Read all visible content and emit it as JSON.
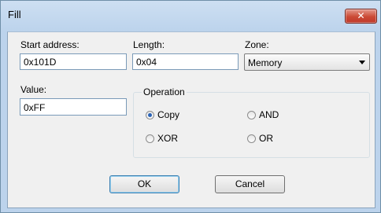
{
  "window": {
    "title": "Fill",
    "close_glyph": "✕"
  },
  "fields": {
    "start_address": {
      "label": "Start address:",
      "value": "0x101D"
    },
    "length": {
      "label": "Length:",
      "value": "0x04"
    },
    "zone": {
      "label": "Zone:",
      "selected": "Memory"
    },
    "value": {
      "label": "Value:",
      "value": "0xFF"
    }
  },
  "operation": {
    "title": "Operation",
    "options": [
      {
        "label": "Copy",
        "checked": true
      },
      {
        "label": "AND",
        "checked": false
      },
      {
        "label": "XOR",
        "checked": false
      },
      {
        "label": "OR",
        "checked": false
      }
    ]
  },
  "buttons": {
    "ok": "OK",
    "cancel": "Cancel"
  },
  "colors": {
    "title_bar": "#bcd3ec",
    "close_button": "#c94a38",
    "dialog_bg": "#f0f0f0"
  },
  "icons": [
    "close-icon",
    "chevron-down-icon"
  ]
}
